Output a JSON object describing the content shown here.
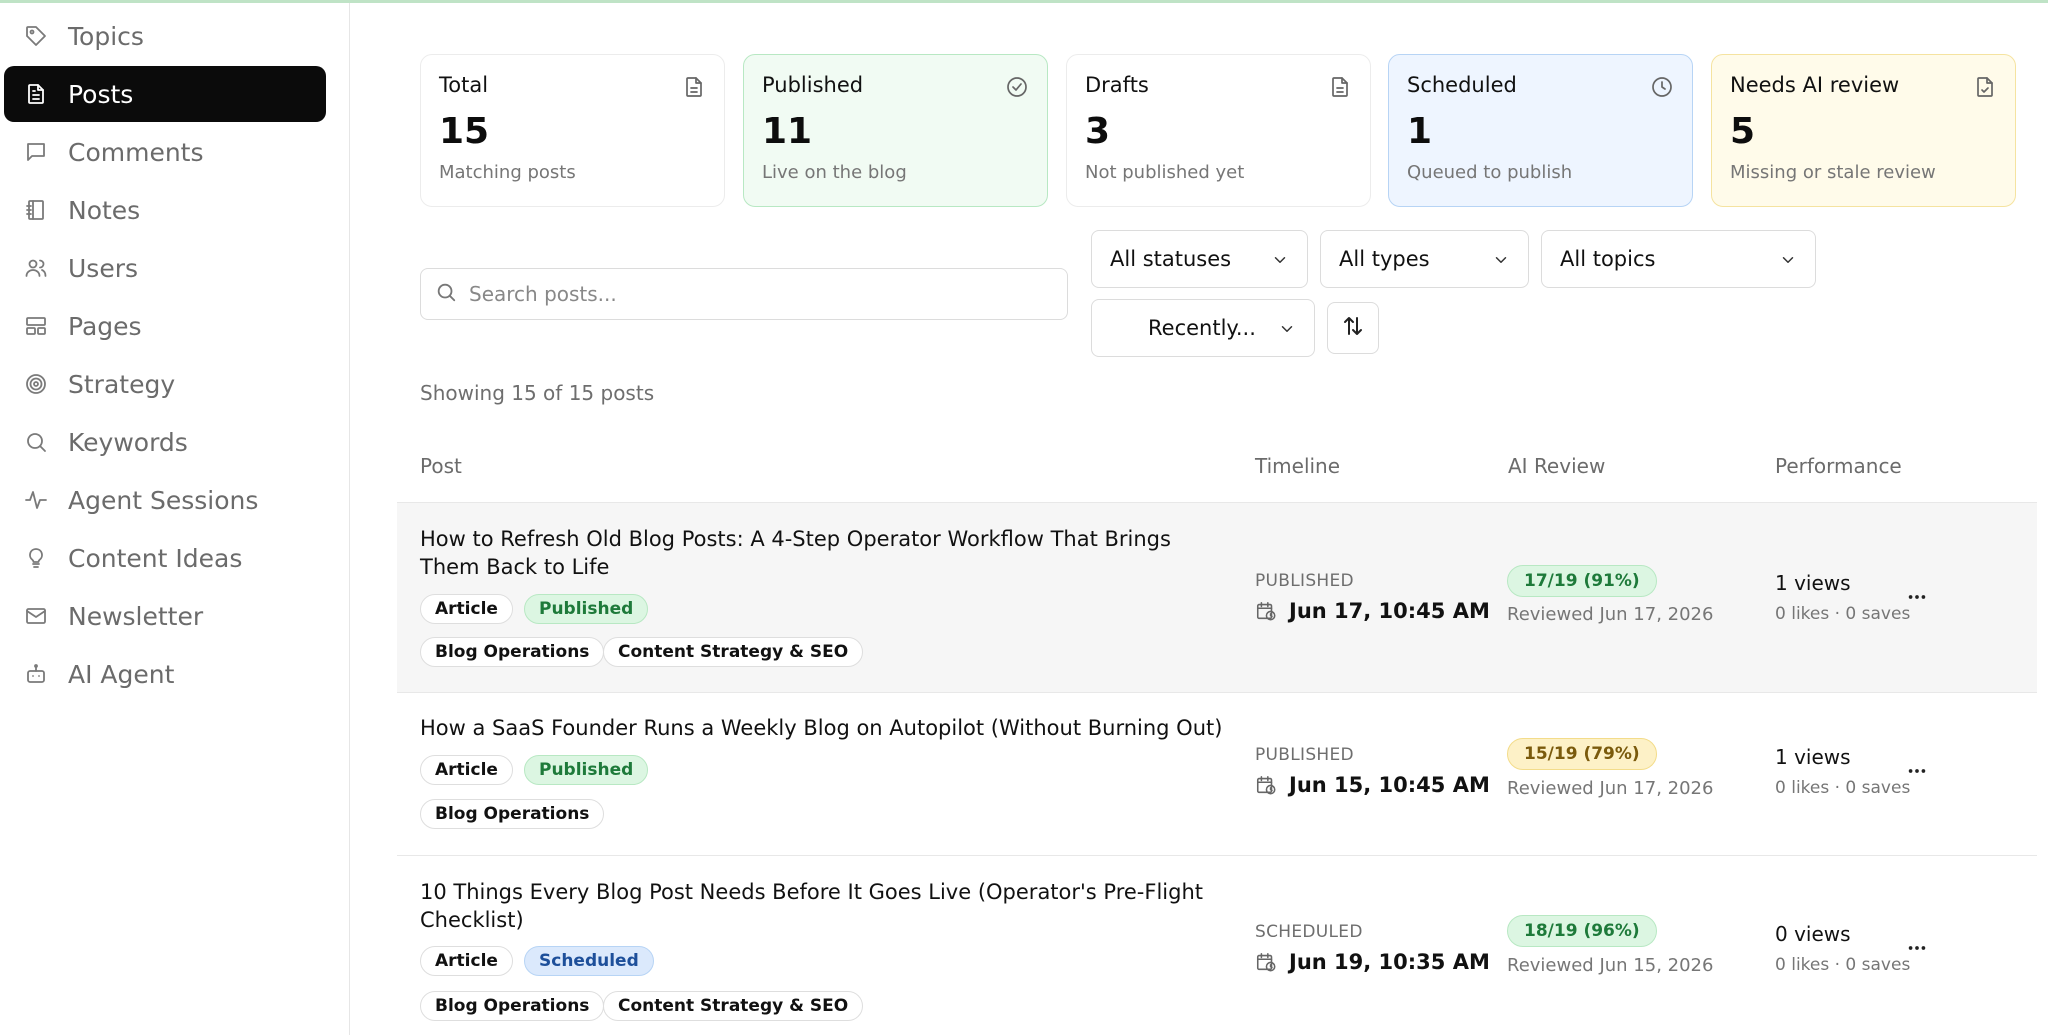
{
  "sidebar": {
    "items": [
      {
        "label": "Topics",
        "icon": "tag-icon"
      },
      {
        "label": "Posts",
        "icon": "document-icon",
        "active": true
      },
      {
        "label": "Comments",
        "icon": "comment-icon"
      },
      {
        "label": "Notes",
        "icon": "notebook-icon"
      },
      {
        "label": "Users",
        "icon": "users-icon"
      },
      {
        "label": "Pages",
        "icon": "layout-icon"
      },
      {
        "label": "Strategy",
        "icon": "target-icon"
      },
      {
        "label": "Keywords",
        "icon": "search-icon"
      },
      {
        "label": "Agent Sessions",
        "icon": "activity-icon"
      },
      {
        "label": "Content Ideas",
        "icon": "lightbulb-icon"
      },
      {
        "label": "Newsletter",
        "icon": "mail-icon"
      },
      {
        "label": "AI Agent",
        "icon": "bot-icon"
      }
    ]
  },
  "stats": [
    {
      "title": "Total",
      "value": "15",
      "sub": "Matching posts",
      "icon": "document-icon",
      "tone": "neutral"
    },
    {
      "title": "Published",
      "value": "11",
      "sub": "Live on the blog",
      "icon": "check-circle-icon",
      "tone": "green"
    },
    {
      "title": "Drafts",
      "value": "3",
      "sub": "Not published yet",
      "icon": "document-icon",
      "tone": "neutral"
    },
    {
      "title": "Scheduled",
      "value": "1",
      "sub": "Queued to publish",
      "icon": "clock-icon",
      "tone": "blue"
    },
    {
      "title": "Needs AI review",
      "value": "5",
      "sub": "Missing or stale review",
      "icon": "file-check-icon",
      "tone": "yellow"
    }
  ],
  "filters": {
    "search_placeholder": "Search posts...",
    "status": "All statuses",
    "type": "All types",
    "topic": "All topics",
    "sort": "Recently..."
  },
  "showing": "Showing 15 of 15 posts",
  "table": {
    "headers": {
      "post": "Post",
      "timeline": "Timeline",
      "review": "AI Review",
      "performance": "Performance"
    },
    "rows": [
      {
        "title": "How to Refresh Old Blog Posts: A 4-Step Operator Workflow That Brings Them Back to Life",
        "type": "Article",
        "status": "Published",
        "topics": [
          "Blog Operations",
          "Content Strategy & SEO"
        ],
        "timeline_label": "PUBLISHED",
        "timeline_date": "Jun 17, 10:45 AM",
        "score": "17/19 (91%)",
        "reviewed": "Reviewed Jun 17, 2026",
        "views": "1 views",
        "engagement": "0 likes · 0 saves"
      },
      {
        "title": "How a SaaS Founder Runs a Weekly Blog on Autopilot (Without Burning Out)",
        "type": "Article",
        "status": "Published",
        "topics": [
          "Blog Operations"
        ],
        "timeline_label": "PUBLISHED",
        "timeline_date": "Jun 15, 10:45 AM",
        "score": "15/19 (79%)",
        "reviewed": "Reviewed Jun 17, 2026",
        "views": "1 views",
        "engagement": "0 likes · 0 saves"
      },
      {
        "title": "10 Things Every Blog Post Needs Before It Goes Live (Operator's Pre-Flight Checklist)",
        "type": "Article",
        "status": "Scheduled",
        "topics": [
          "Blog Operations",
          "Content Strategy & SEO"
        ],
        "timeline_label": "SCHEDULED",
        "timeline_date": "Jun 19, 10:35 AM",
        "score": "18/19 (96%)",
        "reviewed": "Reviewed Jun 15, 2026",
        "views": "0 views",
        "engagement": "0 likes · 0 saves"
      }
    ]
  },
  "colors": {
    "active_nav": "#0b0b0b",
    "published_green": "#1e7a3a",
    "scheduled_blue": "#1d4f9a",
    "warning_yellow": "#7a5a0c"
  }
}
